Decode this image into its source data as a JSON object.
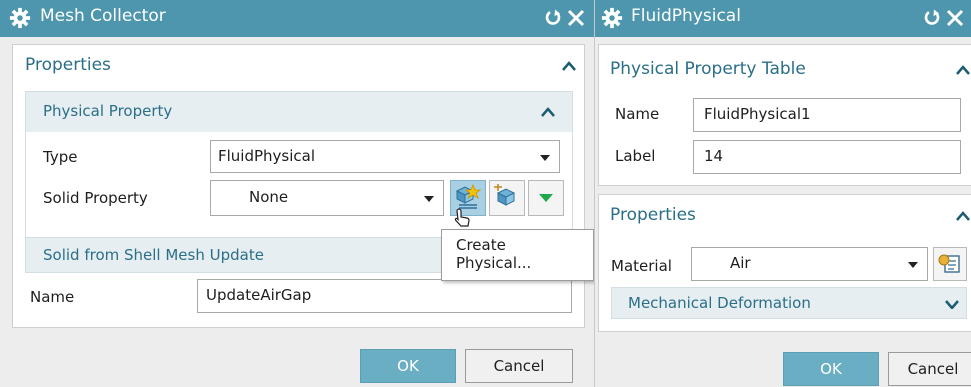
{
  "mesh_collector": {
    "title": "Mesh Collector",
    "properties": {
      "title": "Properties",
      "physical_property": {
        "title": "Physical Property",
        "type_label": "Type",
        "type_value": "FluidPhysical",
        "solid_property_label": "Solid Property",
        "solid_property_value": "None"
      }
    },
    "solid_from_shell_title": "Solid from Shell Mesh Update",
    "name_label": "Name",
    "name_value": "UpdateAirGap",
    "ok_label": "OK",
    "cancel_label": "Cancel",
    "tooltip": "Create Physical..."
  },
  "fluid_physical": {
    "title": "FluidPhysical",
    "table": {
      "title": "Physical Property Table",
      "name_label": "Name",
      "name_value": "FluidPhysical1",
      "label_label": "Label",
      "label_value": "14"
    },
    "properties": {
      "title": "Properties",
      "material_label": "Material",
      "material_value": "Air",
      "mechanical_deformation": "Mechanical Deformation"
    },
    "ok_label": "OK",
    "cancel_label": "Cancel"
  },
  "colors": {
    "titlebar": "#4d96ad",
    "section_text": "#2a6f87",
    "ok_button": "#6aaec4",
    "green_arrow": "#1ea84a"
  }
}
